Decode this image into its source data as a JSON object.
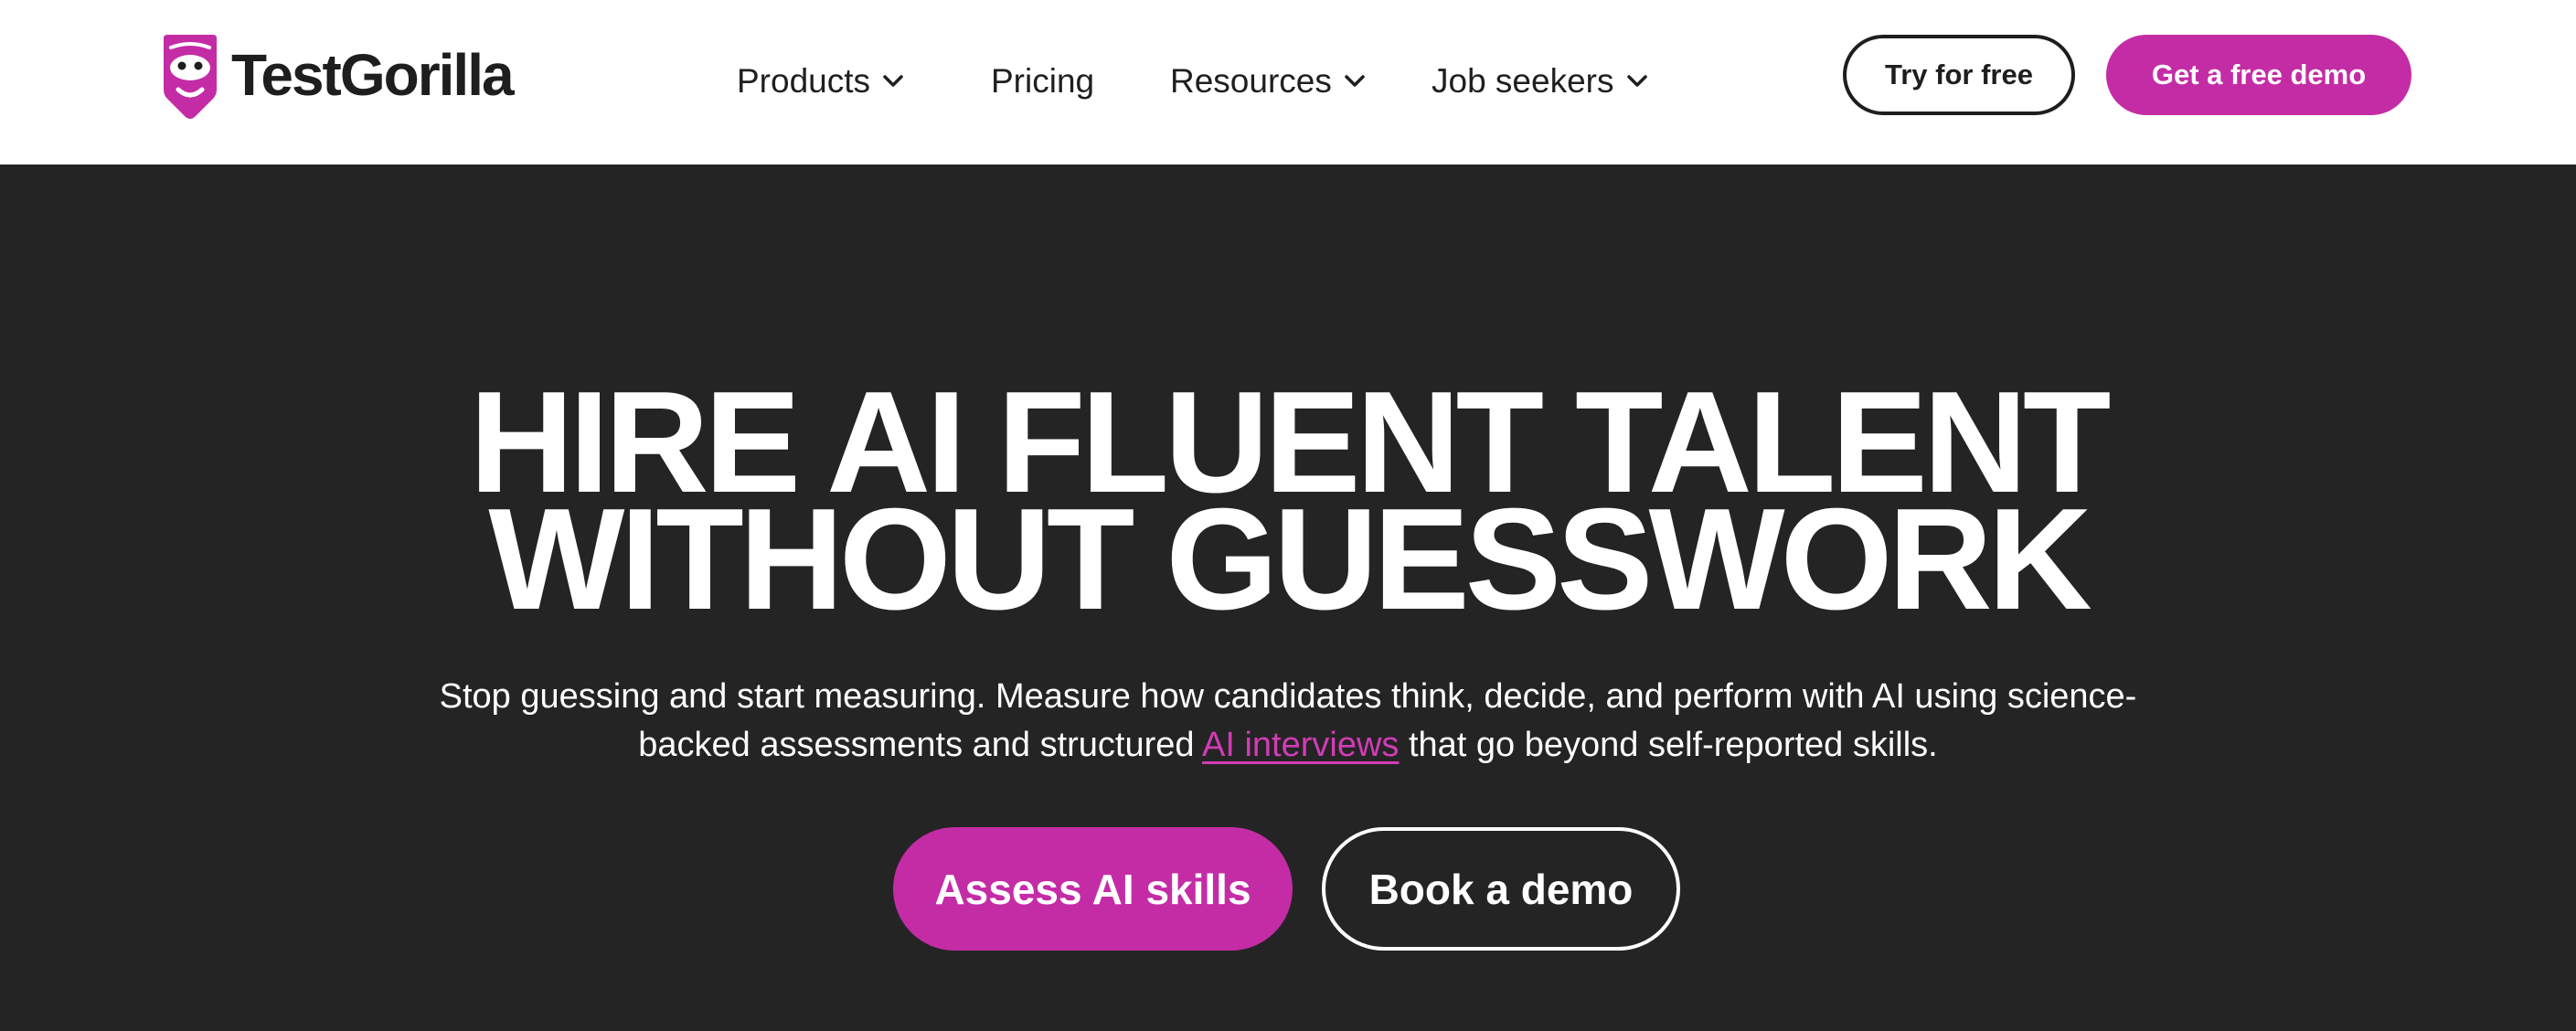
{
  "brand": {
    "name": "TestGorilla",
    "logo_icon": "gorilla-head-icon",
    "accent_color": "#c42ca6",
    "link_color": "#d23cb5",
    "dark_bg": "#242424"
  },
  "nav": {
    "items": [
      {
        "label": "Products",
        "has_dropdown": true,
        "icon": "chevron-down-icon"
      },
      {
        "label": "Pricing",
        "has_dropdown": false
      },
      {
        "label": "Resources",
        "has_dropdown": true,
        "icon": "chevron-down-icon"
      },
      {
        "label": "Job seekers",
        "has_dropdown": true,
        "icon": "chevron-down-icon"
      }
    ],
    "try_free_label": "Try for free",
    "demo_label": "Get a free demo"
  },
  "hero": {
    "title_line1": "HIRE AI FLUENT TALENT",
    "title_line2": "WITHOUT GUESSWORK",
    "subtitle_line1": "Stop guessing and start measuring. Measure how candidates think, decide, and perform with AI using science-",
    "subtitle_line2_before": "backed assessments and structured ",
    "subtitle_link": "AI interviews",
    "subtitle_line2_after": " that go beyond self-reported skills.",
    "primary_cta": "Assess AI skills",
    "secondary_cta": "Book a demo"
  }
}
